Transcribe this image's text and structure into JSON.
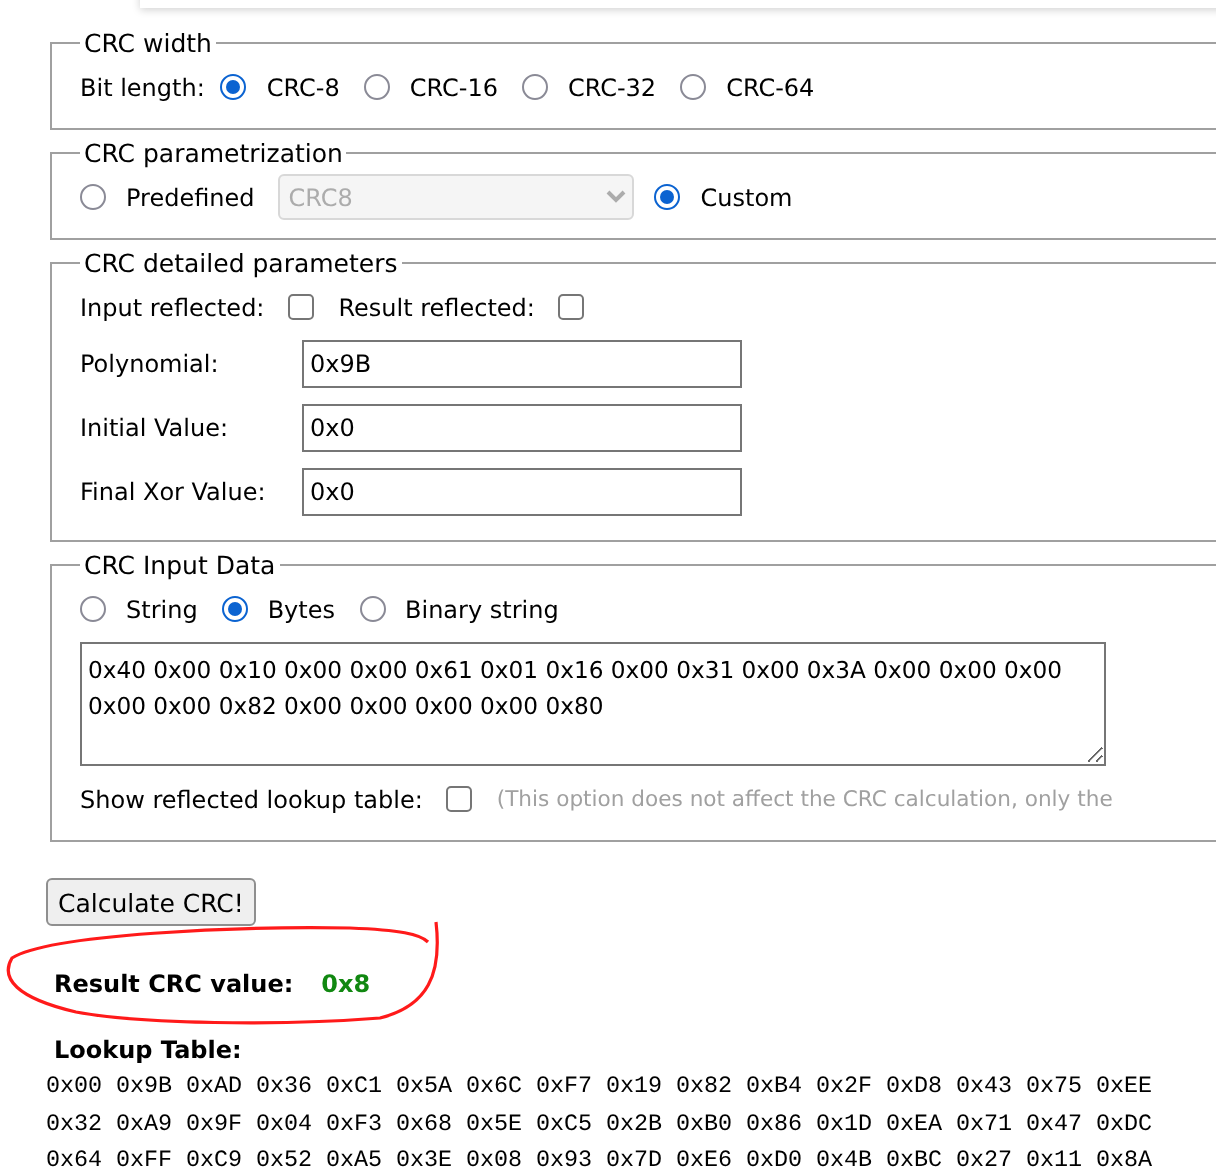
{
  "crc_width": {
    "legend": "CRC width",
    "label": "Bit length:",
    "options": [
      {
        "label": "CRC-8",
        "selected": true
      },
      {
        "label": "CRC-16",
        "selected": false
      },
      {
        "label": "CRC-32",
        "selected": false
      },
      {
        "label": "CRC-64",
        "selected": false
      }
    ]
  },
  "parametrization": {
    "legend": "CRC parametrization",
    "options": [
      {
        "label": "Predefined",
        "selected": false
      },
      {
        "label": "Custom",
        "selected": true
      }
    ],
    "predefined_select": {
      "value": "CRC8",
      "disabled": true
    }
  },
  "detailed": {
    "legend": "CRC detailed parameters",
    "checkboxes": [
      {
        "label": "Input reflected:",
        "checked": false
      },
      {
        "label": "Result reflected:",
        "checked": false
      }
    ],
    "fields": [
      {
        "label": "Polynomial:",
        "value": "0x9B"
      },
      {
        "label": "Initial Value:",
        "value": "0x0"
      },
      {
        "label": "Final Xor Value:",
        "value": "0x0"
      }
    ]
  },
  "input_data": {
    "legend": "CRC Input Data",
    "options": [
      {
        "label": "String",
        "selected": false
      },
      {
        "label": "Bytes",
        "selected": true
      },
      {
        "label": "Binary string",
        "selected": false
      }
    ],
    "text": "0x40 0x00 0x10 0x00 0x00 0x61 0x01 0x16 0x00 0x31 0x00 0x3A 0x00 0x00 0x00 0x00 0x00 0x82 0x00 0x00 0x00 0x00 0x80",
    "reflected_table": {
      "label": "Show reflected lookup table:",
      "checked": false,
      "note": "(This option does not affect the CRC calculation, only the"
    }
  },
  "calculate_button": "Calculate CRC!",
  "result": {
    "label": "Result CRC value:",
    "value": "0x8"
  },
  "lookup_table": {
    "title": "Lookup Table:",
    "rows": [
      [
        "0x00",
        "0x9B",
        "0xAD",
        "0x36",
        "0xC1",
        "0x5A",
        "0x6C",
        "0xF7",
        "0x19",
        "0x82",
        "0xB4",
        "0x2F",
        "0xD8",
        "0x43",
        "0x75",
        "0xEE"
      ],
      [
        "0x32",
        "0xA9",
        "0x9F",
        "0x04",
        "0xF3",
        "0x68",
        "0x5E",
        "0xC5",
        "0x2B",
        "0xB0",
        "0x86",
        "0x1D",
        "0xEA",
        "0x71",
        "0x47",
        "0xDC"
      ],
      [
        "0x64",
        "0xFF",
        "0xC9",
        "0x52",
        "0xA5",
        "0x3E",
        "0x08",
        "0x93",
        "0x7D",
        "0xE6",
        "0xD0",
        "0x4B",
        "0xBC",
        "0x27",
        "0x11",
        "0x8A"
      ]
    ]
  }
}
